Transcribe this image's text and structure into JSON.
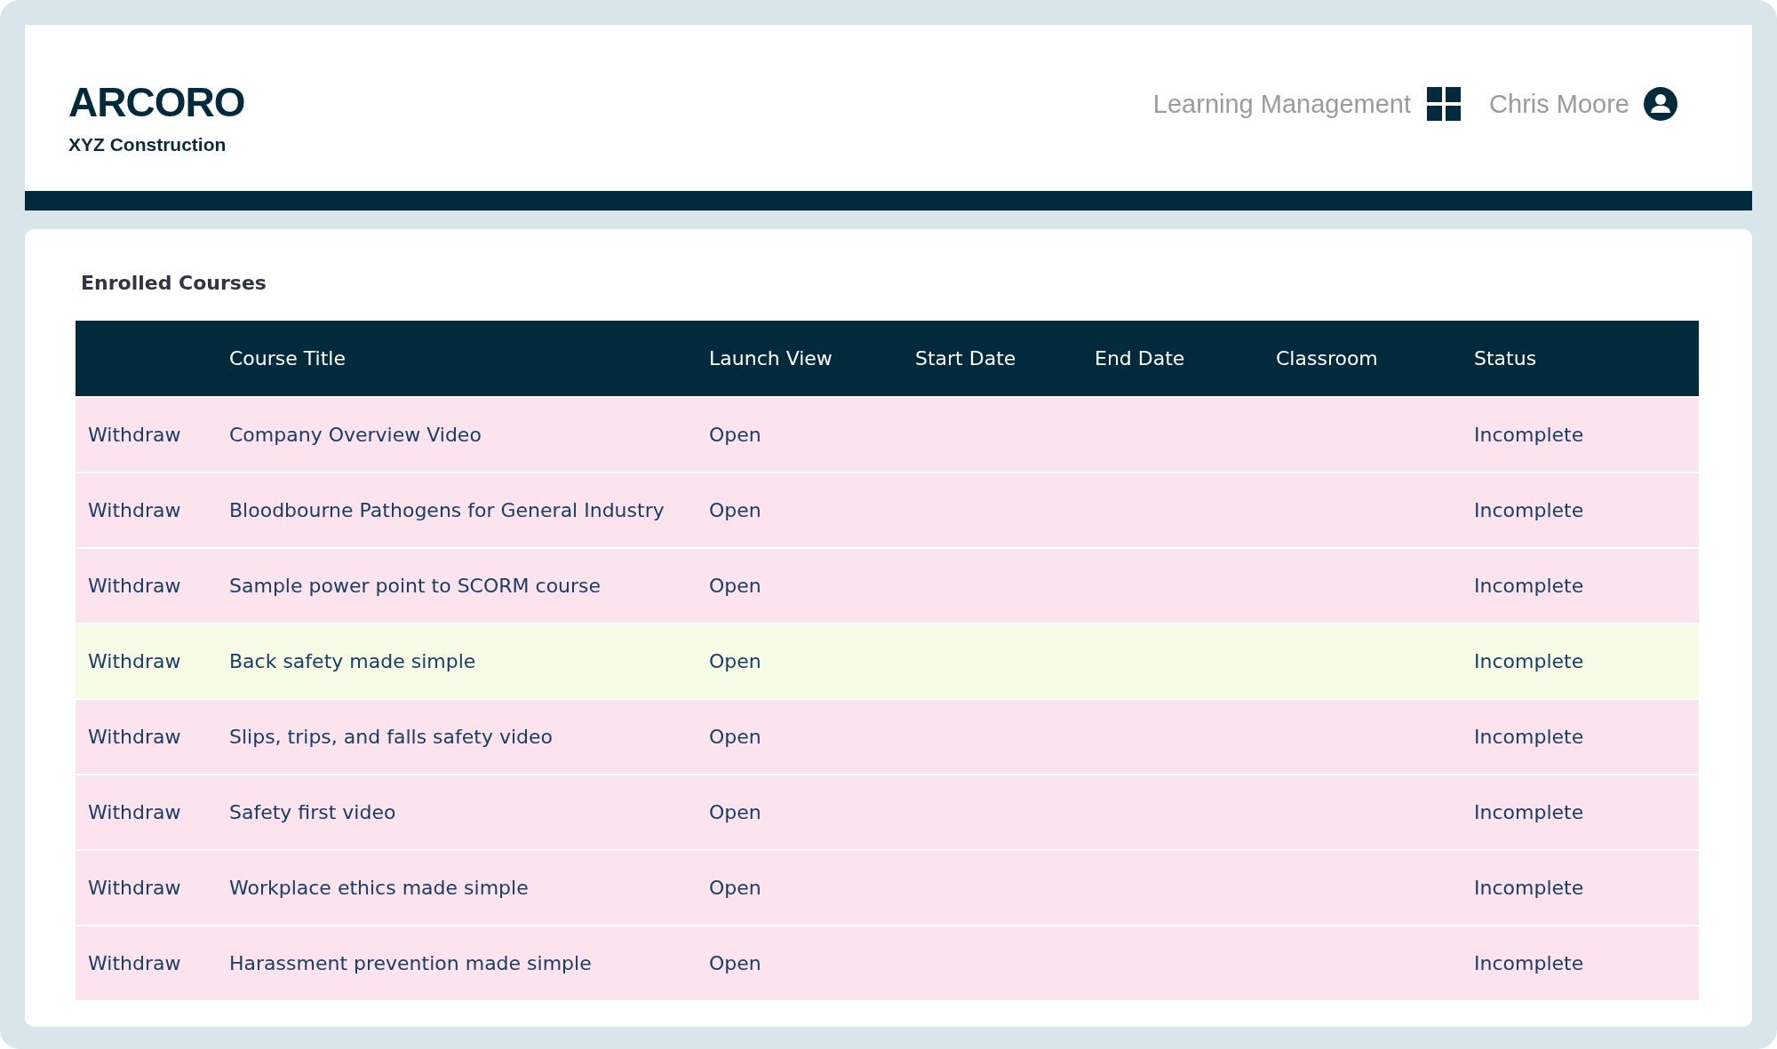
{
  "header": {
    "logo": "ARCORO",
    "company": "XYZ Construction",
    "app_name": "Learning Management",
    "user_name": "Chris Moore"
  },
  "section_title": "Enrolled Courses",
  "table": {
    "columns": [
      "Course Title",
      "Launch View",
      "Start Date",
      "End Date",
      "Classroom",
      "Status"
    ],
    "rows": [
      {
        "action": "Withdraw",
        "course_title": "Company Overview Video",
        "launch_view": "Open",
        "status": "Incomplete",
        "selected": false
      },
      {
        "action": "Withdraw",
        "course_title": "Bloodbourne Pathogens for General Industry",
        "launch_view": "Open",
        "status": "Incomplete",
        "selected": false
      },
      {
        "action": "Withdraw",
        "course_title": "Sample power point to SCORM course",
        "launch_view": "Open",
        "status": "Incomplete",
        "selected": false
      },
      {
        "action": "Withdraw",
        "course_title": "Back safety made simple",
        "launch_view": "Open",
        "status": "Incomplete",
        "selected": true
      },
      {
        "action": "Withdraw",
        "course_title": "Slips, trips, and falls safety video",
        "launch_view": "Open",
        "status": "Incomplete",
        "selected": false
      },
      {
        "action": "Withdraw",
        "course_title": "Safety first video",
        "launch_view": "Open",
        "status": "Incomplete",
        "selected": false
      },
      {
        "action": "Withdraw",
        "course_title": "Workplace ethics made simple",
        "launch_view": "Open",
        "status": "Incomplete",
        "selected": false
      },
      {
        "action": "Withdraw",
        "course_title": "Harassment prevention made simple",
        "launch_view": "Open",
        "status": "Incomplete",
        "selected": false
      }
    ]
  }
}
